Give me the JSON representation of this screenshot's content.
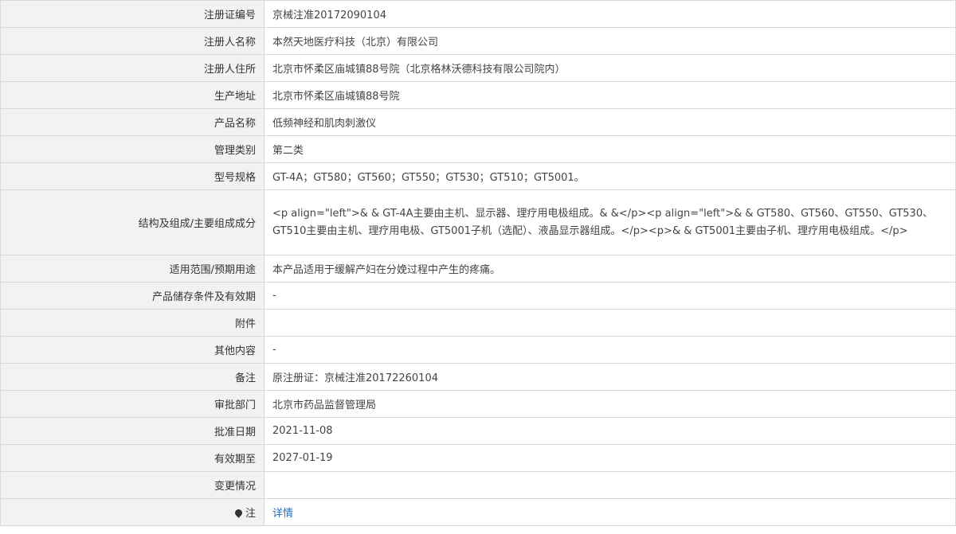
{
  "rows": [
    {
      "label": "注册证编号",
      "value": "京械注准20172090104"
    },
    {
      "label": "注册人名称",
      "value": "本然天地医疗科技（北京）有限公司"
    },
    {
      "label": "注册人住所",
      "value": "北京市怀柔区庙城镇88号院（北京格林沃德科技有限公司院内）"
    },
    {
      "label": "生产地址",
      "value": "北京市怀柔区庙城镇88号院"
    },
    {
      "label": "产品名称",
      "value": "低频神经和肌肉刺激仪"
    },
    {
      "label": "管理类别",
      "value": "第二类"
    },
    {
      "label": "型号规格",
      "value": "GT-4A；GT580；GT560；GT550；GT530；GT510；GT5001。"
    },
    {
      "label": "结构及组成/主要组成成分",
      "value": "<p align=\"left\">& & GT-4A主要由主机、显示器、理疗用电极组成。& &</p><p align=\"left\">& & GT580、GT560、GT550、GT530、GT510主要由主机、理疗用电极、GT5001子机（选配）、液晶显示器组成。</p><p>& & GT5001主要由子机、理疗用电极组成。</p>"
    },
    {
      "label": "适用范围/预期用途",
      "value": "本产品适用于缓解产妇在分娩过程中产生的疼痛。"
    },
    {
      "label": "产品储存条件及有效期",
      "value": "-"
    },
    {
      "label": "附件",
      "value": ""
    },
    {
      "label": "其他内容",
      "value": "-"
    },
    {
      "label": "备注",
      "value": "原注册证：京械注准20172260104"
    },
    {
      "label": "审批部门",
      "value": "北京市药品监督管理局"
    },
    {
      "label": "批准日期",
      "value": "2021-11-08"
    },
    {
      "label": "有效期至",
      "value": "2027-01-19"
    },
    {
      "label": "变更情况",
      "value": ""
    }
  ],
  "note": {
    "label": "注",
    "icon": "pin-icon",
    "link_text": "详情",
    "link_color": "#2a6ebd"
  }
}
